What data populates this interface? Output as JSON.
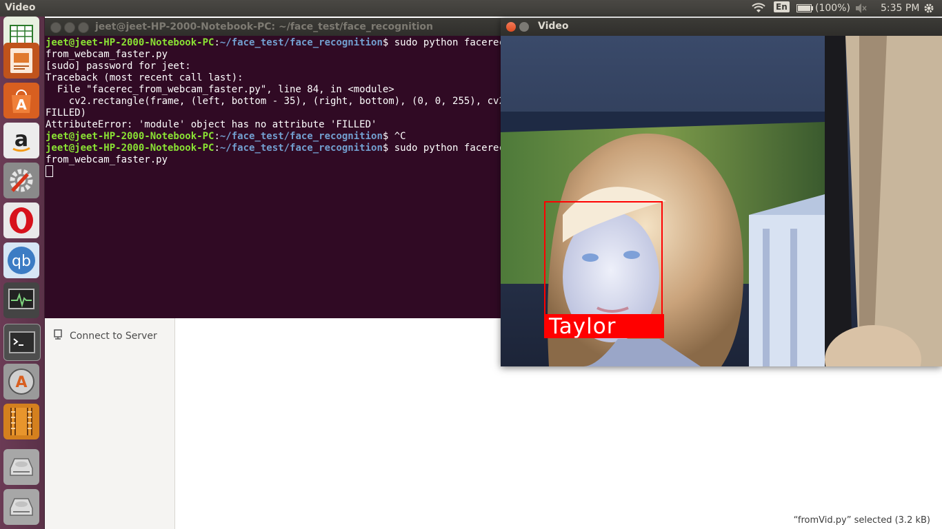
{
  "top_panel": {
    "app_title": "Video",
    "language": "En",
    "battery": "(100%)",
    "clock": "5:35 PM"
  },
  "launcher": {
    "items": [
      "spreadsheet-icon",
      "presentation-icon",
      "software-center-icon",
      "amazon-icon",
      "system-settings-icon",
      "opera-icon",
      "qbittorrent-icon",
      "system-monitor-icon",
      "terminal-icon",
      "software-updater-icon",
      "video-player-icon",
      "disk-icon",
      "disk-icon"
    ]
  },
  "files": {
    "connect_to_server": "Connect to Server",
    "status": "“fromVid.py” selected  (3.2 kB)"
  },
  "terminal": {
    "title": "jeet@jeet-HP-2000-Notebook-PC: ~/face_test/face_recognition",
    "prompt_user": "jeet@jeet-HP-2000-Notebook-PC",
    "prompt_path": "~/face_test/face_recognition",
    "line1_cmd": "$ sudo python facerec_",
    "line2": "from_webcam_faster.py",
    "line3": "[sudo] password for jeet:",
    "line4": "Traceback (most recent call last):",
    "line5": "  File \"facerec_from_webcam_faster.py\", line 84, in <module>",
    "line6": "    cv2.rectangle(frame, (left, bottom - 35), (right, bottom), (0, 0, 255), cv2.",
    "line7": "FILLED)",
    "line8": "AttributeError: 'module' object has no attribute 'FILLED'",
    "line9_cmd": "$ ^C",
    "line10_cmd": "$ sudo python facerec_",
    "line11": "from_webcam_faster.py"
  },
  "video": {
    "title": "Video",
    "face_name": "Taylor"
  }
}
